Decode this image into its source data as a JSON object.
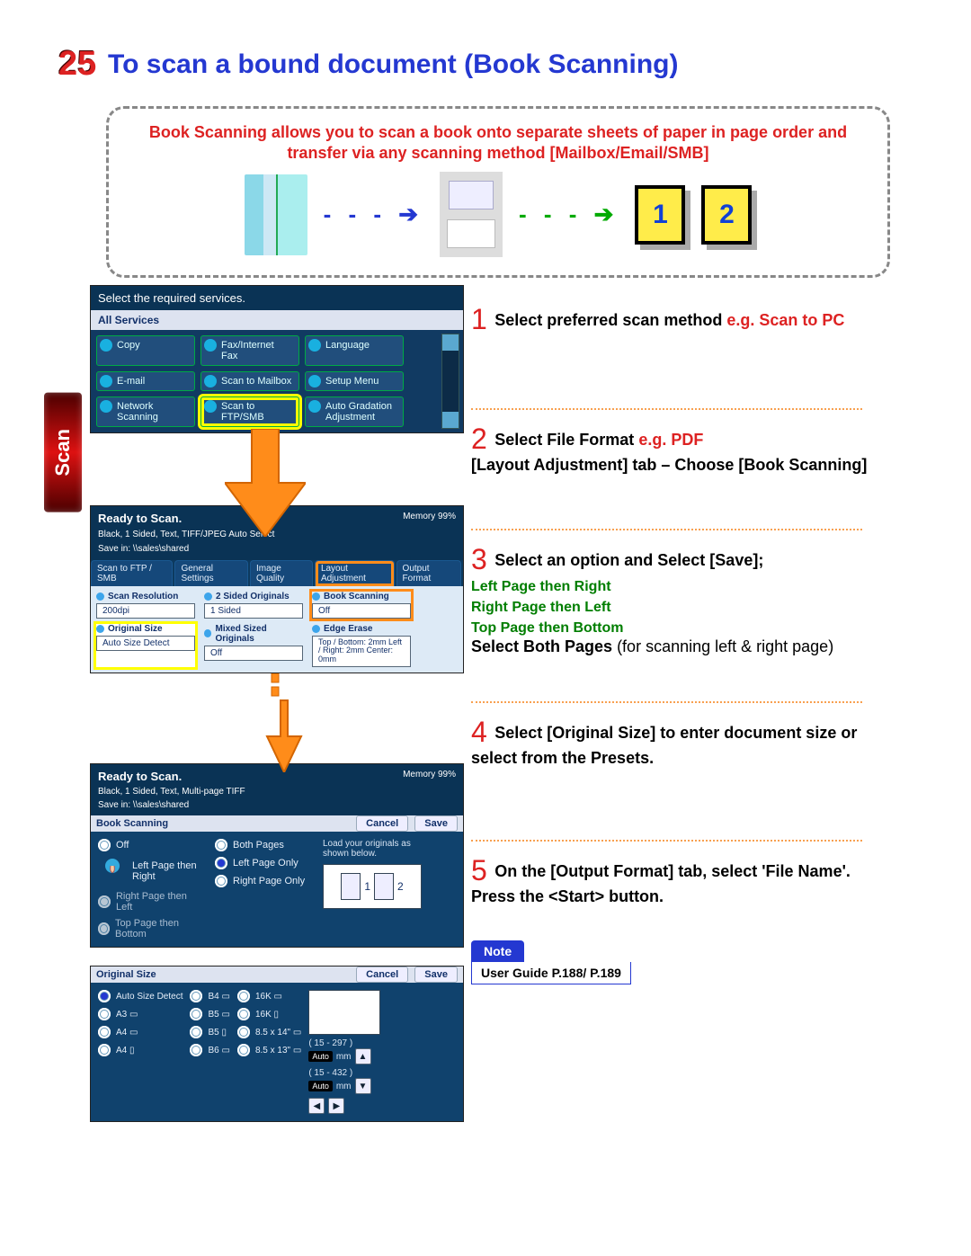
{
  "pageNumber": "25",
  "title": "To scan a bound document (Book Scanning)",
  "intro": "Book Scanning allows you to scan a book onto separate sheets of paper in page order and transfer via any scanning method [Mailbox/Email/SMB]",
  "introIcons": {
    "page1": "1",
    "page2": "2"
  },
  "sideTab": "Scan",
  "screenshot1": {
    "titlebar": "Select the required services.",
    "allServices": "All Services",
    "buttons": {
      "copy": "Copy",
      "fax": "Fax/Internet Fax",
      "language": "Language",
      "email": "E-mail",
      "scanMailbox": "Scan to Mailbox",
      "setupMenu": "Setup Menu",
      "networkScanning": "Network Scanning",
      "scanFtpSmb": "Scan to FTP/SMB",
      "autoGradation": "Auto Gradation Adjustment"
    }
  },
  "screenshot2": {
    "readyBold": "Ready to Scan.",
    "readyLine2": "Black, 1 Sided, Text, TIFF/JPEG Auto Select",
    "readyLine3": "Save in: \\\\sales\\shared",
    "memory": "Memory 99%",
    "tabs": {
      "scanTo": "Scan to FTP / SMB",
      "general": "General Settings",
      "imageQuality": "Image Quality",
      "layout": "Layout Adjustment",
      "outputFormat": "Output Format"
    },
    "options": {
      "scanRes": {
        "h": "Scan Resolution",
        "v": "200dpi"
      },
      "twoSided": {
        "h": "2 Sided Originals",
        "v": "1 Sided"
      },
      "bookScanning": {
        "h": "Book Scanning",
        "v": "Off"
      },
      "originalSize": {
        "h": "Original Size",
        "v": "Auto Size Detect"
      },
      "mixedSize": {
        "h": "Mixed Sized Originals",
        "v": "Off"
      },
      "edgeErase": {
        "h": "Edge Erase",
        "v": "Top / Bottom: 2mm Left / Right: 2mm Center: 0mm"
      }
    }
  },
  "screenshot3": {
    "readyBold": "Ready to Scan.",
    "readyLine2": "Black, 1 Sided, Text, Multi-page TIFF",
    "readyLine3": "Save in: \\\\sales\\shared",
    "memory": "Memory 99%",
    "bar": "Book Scanning",
    "cancel": "Cancel",
    "save": "Save",
    "off": "Off",
    "leftRight": "Left Page then Right",
    "rightLeft": "Right Page then Left",
    "topBottom": "Top Page then Bottom",
    "bothPages": "Both Pages",
    "leftOnly": "Left Page Only",
    "rightOnly": "Right Page Only",
    "note": "Load your originals as shown below."
  },
  "screenshot4": {
    "bar": "Original Size",
    "cancel": "Cancel",
    "save": "Save",
    "opts": {
      "auto": "Auto Size Detect",
      "a3": "A3 ▭",
      "a4l": "A4 ▭",
      "a4p": "A4 ▯",
      "b4": "B4 ▭",
      "b5l": "B5 ▭",
      "b5p": "B5 ▯",
      "b6": "B6 ▭",
      "k16l": "16K ▭",
      "k16p": "16K ▯",
      "s85x14": "8.5 x 14\" ▭",
      "s85x13": "8.5 x 13\" ▭"
    },
    "dimY": "( 15 - 297 )",
    "dimX": "( 15 - 432 )",
    "auto": "Auto",
    "mm": "mm"
  },
  "steps": {
    "s1": {
      "n": "1",
      "t1": "Select preferred scan method ",
      "eg": "e.g. Scan to PC"
    },
    "s2": {
      "n": "2",
      "t1": "Select File Format ",
      "eg": "e.g. PDF",
      "t2": "[Layout Adjustment] tab – Choose [Book Scanning]"
    },
    "s3": {
      "n": "3",
      "t1": "Select an option and Select [Save];",
      "g1": "Left Page then Right",
      "g2": "Right Page then Left",
      "g3": "Top Page then Bottom",
      "b1": "Select Both Pages",
      "b2": "  (for scanning left & right page)"
    },
    "s4": {
      "n": "4",
      "t1": "Select [Original Size] to enter document size or select from the Presets."
    },
    "s5": {
      "n": "5",
      "t1": "On the [Output Format] tab, select 'File Name'. Press the <Start> button."
    }
  },
  "note": {
    "label": "Note",
    "text": "User Guide P.188/ P.189"
  }
}
